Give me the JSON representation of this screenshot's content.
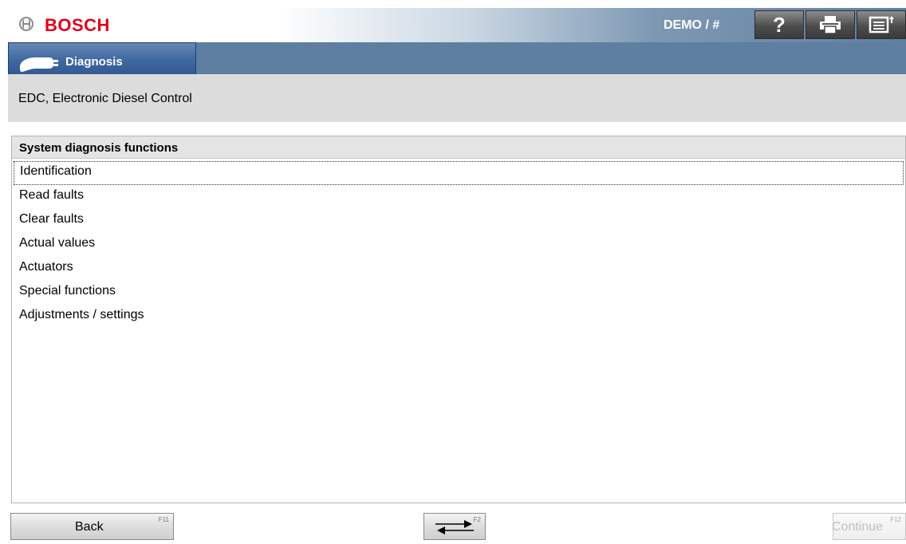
{
  "header": {
    "brand": "BOSCH",
    "session_label": "DEMO / #",
    "help_label": "?",
    "icons": [
      "bosch-logo-icon",
      "printer-icon",
      "menu-list-icon"
    ]
  },
  "tab": {
    "label": "Diagnosis",
    "icon": "diagnosis-plug-icon"
  },
  "breadcrumb": {
    "text": "EDC, Electronic Diesel Control"
  },
  "list": {
    "header": "System diagnosis functions",
    "selected_index": 0,
    "items": [
      {
        "label": "Identification"
      },
      {
        "label": "Read faults"
      },
      {
        "label": "Clear faults"
      },
      {
        "label": "Actual values"
      },
      {
        "label": "Actuators"
      },
      {
        "label": "Special functions"
      },
      {
        "label": "Adjustments / settings"
      }
    ]
  },
  "footer": {
    "back_label": "Back",
    "back_key": "F11",
    "swap_key": "F2",
    "continue_label": "Continue",
    "continue_key": "F12"
  },
  "colors": {
    "brand_red": "#e2001a",
    "header_blue": "#5f7fa0",
    "tab_blue": "#3e67a0"
  }
}
